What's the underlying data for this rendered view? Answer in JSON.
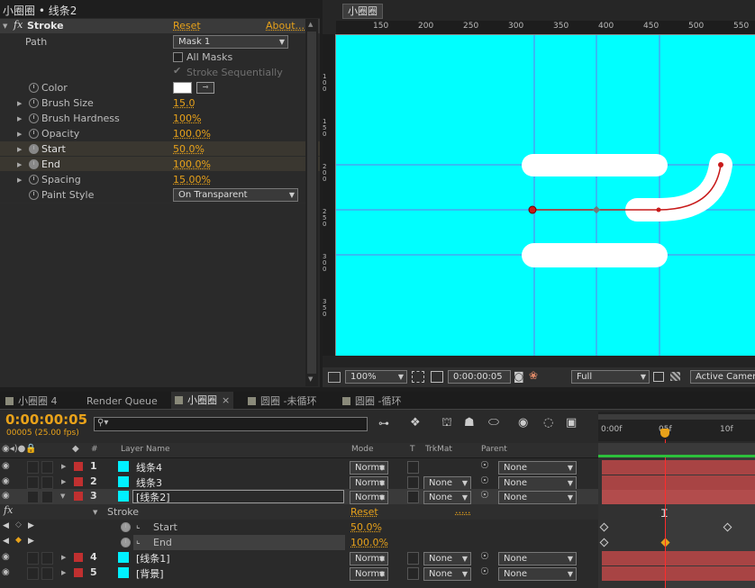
{
  "effect_controls": {
    "panel_title": "小圈圈 • 线条2",
    "effect_name": "Stroke",
    "reset_label": "Reset",
    "about_label": "About...",
    "params": {
      "path": {
        "label": "Path",
        "value": "Mask 1"
      },
      "all_masks": {
        "label": "All Masks"
      },
      "stroke_seq": {
        "label": "Stroke Sequentially"
      },
      "color": {
        "label": "Color",
        "value": "#ffffff"
      },
      "brush_size": {
        "label": "Brush Size",
        "value": "15.0"
      },
      "brush_hardness": {
        "label": "Brush Hardness",
        "value": "100%"
      },
      "opacity": {
        "label": "Opacity",
        "value": "100.0%"
      },
      "start": {
        "label": "Start",
        "value": "50.0%"
      },
      "end": {
        "label": "End",
        "value": "100.0%"
      },
      "spacing": {
        "label": "Spacing",
        "value": "15.00%"
      },
      "paint_style": {
        "label": "Paint Style",
        "value": "On Transparent"
      }
    }
  },
  "composition": {
    "tab_label": "小圈圈",
    "ruler_labels": [
      "150",
      "200",
      "250",
      "300",
      "350",
      "400",
      "450",
      "500",
      "550"
    ],
    "vruler_labels": [
      "100",
      "150",
      "200",
      "250",
      "300",
      "350"
    ],
    "bg_color": "#00ffff",
    "zoom": "100%",
    "timecode": "0:00:00:05",
    "resolution": "Full",
    "camera": "Active Camera"
  },
  "tabs": [
    {
      "label": "小圈圈 4"
    },
    {
      "label": "Render Queue"
    },
    {
      "label": "小圈圈"
    },
    {
      "label": "圆圈 -未循环"
    },
    {
      "label": "圆圈 -循环"
    }
  ],
  "timeline": {
    "timecode": "0:00:00:05",
    "frame_info": "00005 (25.00 fps)",
    "search_placeholder": "",
    "ruler": {
      "start": "0:00f",
      "mid": "05f",
      "end": "10f"
    },
    "headers": {
      "num": "#",
      "layer_name": "Layer Name",
      "mode": "Mode",
      "t": "T",
      "trkmat": "TrkMat",
      "parent": "Parent"
    },
    "layers": [
      {
        "num": "1",
        "name": "线条4",
        "mode": "Norma",
        "trkmat": "",
        "parent": "None"
      },
      {
        "num": "2",
        "name": "线条3",
        "mode": "Norma",
        "trkmat": "None",
        "parent": "None"
      },
      {
        "num": "3",
        "name": "[线条2]",
        "mode": "Norma",
        "trkmat": "None",
        "parent": "None"
      },
      {
        "num": "4",
        "name": "[线条1]",
        "mode": "Norma",
        "trkmat": "None",
        "parent": "None"
      },
      {
        "num": "5",
        "name": "[背景]",
        "mode": "Norma",
        "trkmat": "None",
        "parent": "None"
      }
    ],
    "stroke": {
      "label": "Stroke",
      "reset": "Reset",
      "dots": "....."
    },
    "start": {
      "label": "Start",
      "value": "50.0%"
    },
    "end": {
      "label": "End",
      "value": "100.0%"
    }
  }
}
